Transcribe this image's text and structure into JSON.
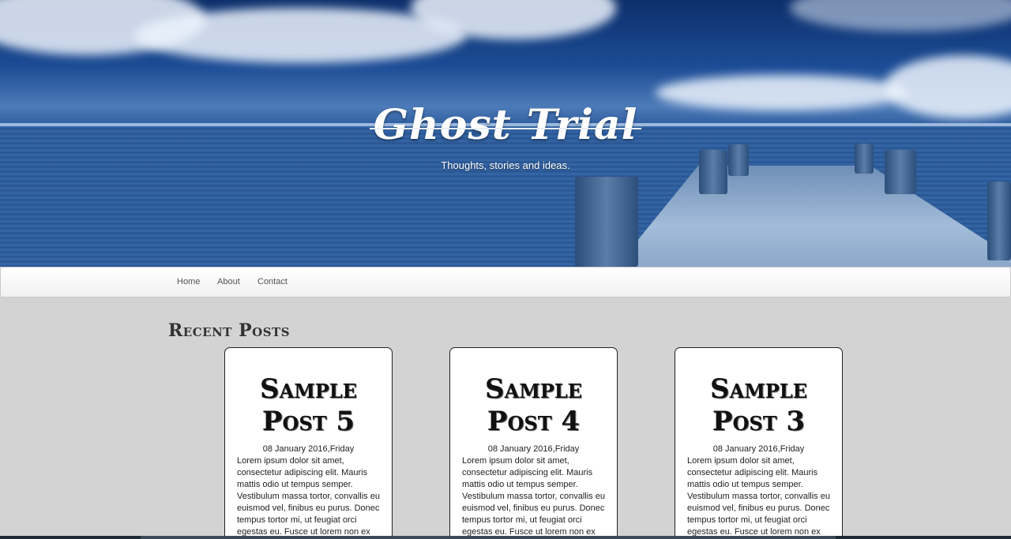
{
  "header": {
    "title": "Ghost Trial",
    "tagline": "Thoughts, stories and ideas."
  },
  "nav": {
    "items": [
      {
        "label": "Home"
      },
      {
        "label": "About"
      },
      {
        "label": "Contact"
      }
    ]
  },
  "main": {
    "heading": "Recent Posts",
    "posts": [
      {
        "title": "Sample Post 5",
        "date": "08 January 2016,Friday",
        "excerpt": "Lorem ipsum dolor sit amet, consectetur adipiscing elit. Mauris mattis odio ut tempus semper. Vestibulum massa tortor, convallis eu euismod vel, finibus eu purus. Donec tempus tortor mi, ut feugiat orci egestas eu. Fusce ut lorem non ex"
      },
      {
        "title": "Sample Post 4",
        "date": "08 January 2016,Friday",
        "excerpt": "Lorem ipsum dolor sit amet, consectetur adipiscing elit. Mauris mattis odio ut tempus semper. Vestibulum massa tortor, convallis eu euismod vel, finibus eu purus. Donec tempus tortor mi, ut feugiat orci egestas eu. Fusce ut lorem non ex"
      },
      {
        "title": "Sample Post 3",
        "date": "08 January 2016,Friday",
        "excerpt": "Lorem ipsum dolor sit amet, consectetur adipiscing elit. Mauris mattis odio ut tempus semper. Vestibulum massa tortor, convallis eu euismod vel, finibus eu purus. Donec tempus tortor mi, ut feugiat orci egestas eu. Fusce ut lorem non ex"
      }
    ]
  },
  "colors": {
    "page_background": "#d3d3d3",
    "hero_blue": "#1c4c95",
    "card_border": "#222222"
  }
}
